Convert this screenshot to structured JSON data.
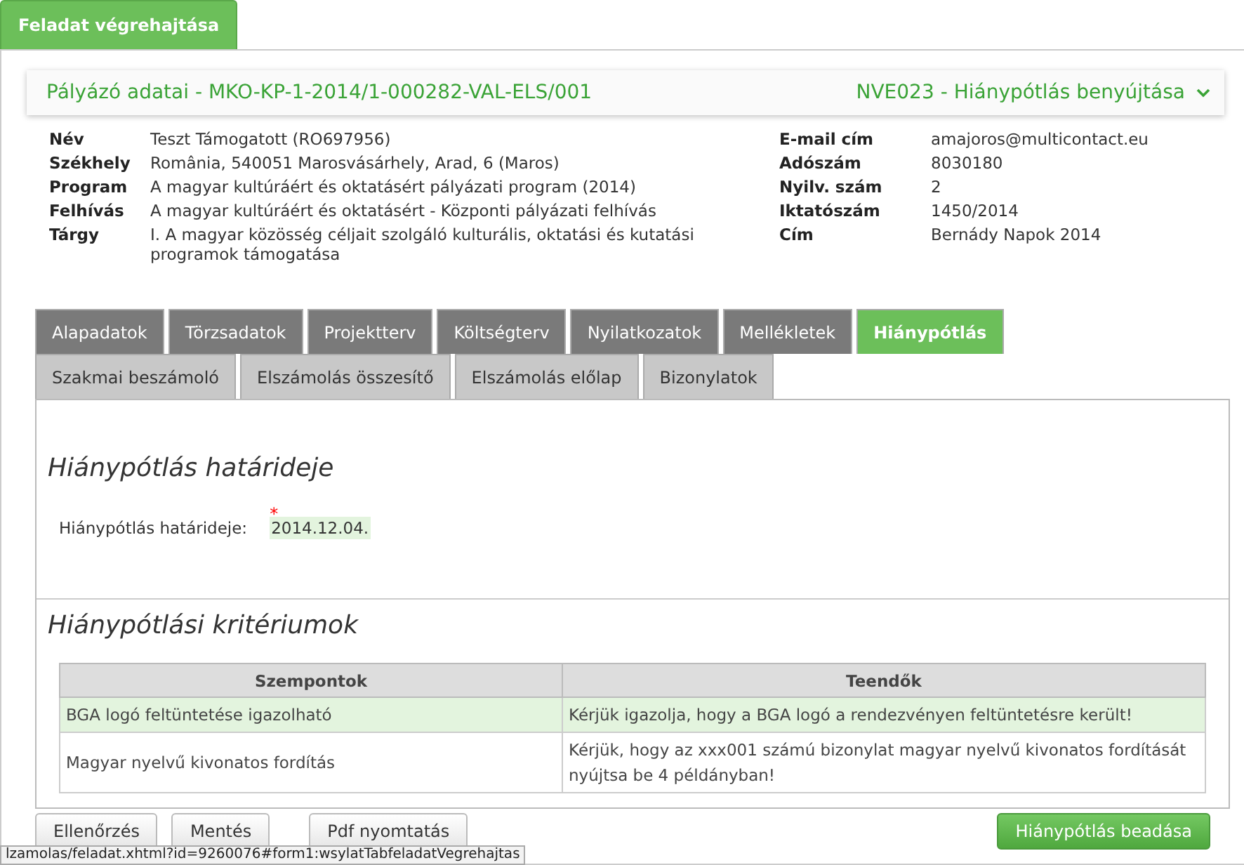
{
  "top_tab": {
    "label": "Feladat végrehajtása",
    "selected": true
  },
  "header": {
    "title": "Pályázó adatai - MKO-KP-1-2014/1-000282-VAL-ELS/001",
    "task": "NVE023 - Hiánypótlás benyújtása",
    "expanded": true
  },
  "details_left": [
    {
      "label": "Név",
      "value": "Teszt Támogatott (RO697956)"
    },
    {
      "label": "Székhely",
      "value": "România, 540051 Marosvásárhely, Arad, 6 (Maros)"
    },
    {
      "label": "Program",
      "value": "A magyar kultúráért és oktatásért pályázati program (2014)"
    },
    {
      "label": "Felhívás",
      "value": "A magyar kultúráért és oktatásért - Központi pályázati felhívás"
    },
    {
      "label": "Tárgy",
      "value": "I. A magyar közösség céljait szolgáló kulturális, oktatási és kutatási programok támogatása"
    }
  ],
  "details_right": [
    {
      "label": "E-mail cím",
      "value": "amajoros@multicontact.eu"
    },
    {
      "label": "Adószám",
      "value": "8030180"
    },
    {
      "label": "Nyilv. szám",
      "value": "2"
    },
    {
      "label": "Iktatószám",
      "value": "1450/2014"
    },
    {
      "label": "Cím",
      "value": "Bernády Napok 2014"
    }
  ],
  "tabs": [
    {
      "label": "Alapadatok",
      "selected": false,
      "kind": "dark"
    },
    {
      "label": "Törzsadatok",
      "selected": false,
      "kind": "dark"
    },
    {
      "label": "Projektterv",
      "selected": false,
      "kind": "dark"
    },
    {
      "label": "Költségterv",
      "selected": false,
      "kind": "dark"
    },
    {
      "label": "Nyilatkozatok",
      "selected": false,
      "kind": "dark"
    },
    {
      "label": "Mellékletek",
      "selected": false,
      "kind": "dark"
    },
    {
      "label": "Hiánypótlás",
      "selected": true,
      "kind": "dark"
    },
    {
      "label": "Szakmai beszámoló",
      "selected": false,
      "kind": "light"
    },
    {
      "label": "Elszámolás összesítő",
      "selected": false,
      "kind": "light"
    },
    {
      "label": "Elszámolás előlap",
      "selected": false,
      "kind": "light"
    },
    {
      "label": "Bizonylatok",
      "selected": false,
      "kind": "light"
    }
  ],
  "deadline_section": {
    "title": "Hiánypótlás határideje",
    "label": "Hiánypótlás határideje:",
    "required_mark": "*",
    "value": "2014.12.04."
  },
  "criteria_section": {
    "title": "Hiánypótlási kritériumok",
    "columns": [
      "Szempontok",
      "Teendők"
    ],
    "rows": [
      {
        "cells": [
          "BGA logó feltüntetése igazolható",
          "Kérjük igazolja, hogy a BGA logó a rendezvényen feltüntetésre került!"
        ],
        "highlighted": true
      },
      {
        "cells": [
          "Magyar nyelvű kivonatos fordítás",
          "Kérjük, hogy az xxx001 számú bizonylat magyar nyelvű kivonatos fordítását nyújtsa be 4 példányban!"
        ],
        "highlighted": false
      }
    ]
  },
  "buttons": [
    "Ellenőrzés",
    "Mentés",
    "Pdf nyomtatás"
  ],
  "submit_button": "Hiánypótlás beadása",
  "status_url": "lzamolas/feladat.xhtml?id=9260076#form1:wsylatTabfeladatVegrehajtas"
}
